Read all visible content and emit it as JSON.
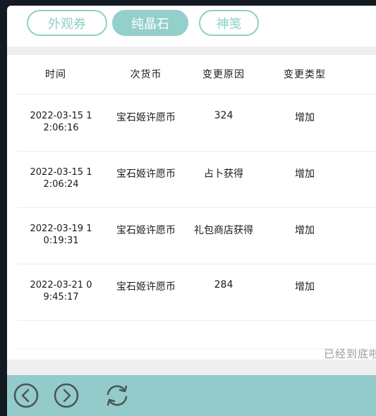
{
  "tabs": [
    {
      "label": "外观券",
      "active": false
    },
    {
      "label": "纯晶石",
      "active": true
    },
    {
      "label": "神笺",
      "active": false
    }
  ],
  "table": {
    "headers": [
      "时间",
      "次货币",
      "变更原因",
      "变更类型"
    ],
    "rows": [
      {
        "time_line1": "2022-03-15 1",
        "time_line2": "2:06:16",
        "currency": "宝石姬许愿币",
        "reason": "324",
        "type": "增加"
      },
      {
        "time_line1": "2022-03-15 1",
        "time_line2": "2:06:24",
        "currency": "宝石姬许愿币",
        "reason": "占卜获得",
        "type": "增加"
      },
      {
        "time_line1": "2022-03-19 1",
        "time_line2": "0:19:31",
        "currency": "宝石姬许愿币",
        "reason": "礼包商店获得",
        "type": "增加"
      },
      {
        "time_line1": "2022-03-21 0",
        "time_line2": "9:45:17",
        "currency": "宝石姬许愿币",
        "reason": "284",
        "type": "增加"
      }
    ],
    "end_message": "已经到底啦"
  },
  "toolbar": {
    "icons": [
      "chevron-left-icon",
      "chevron-right-icon",
      "refresh-icon"
    ]
  },
  "colors": {
    "accent": "#93cfcb",
    "toolbar": "#93cbcb",
    "background": "#131a22"
  }
}
